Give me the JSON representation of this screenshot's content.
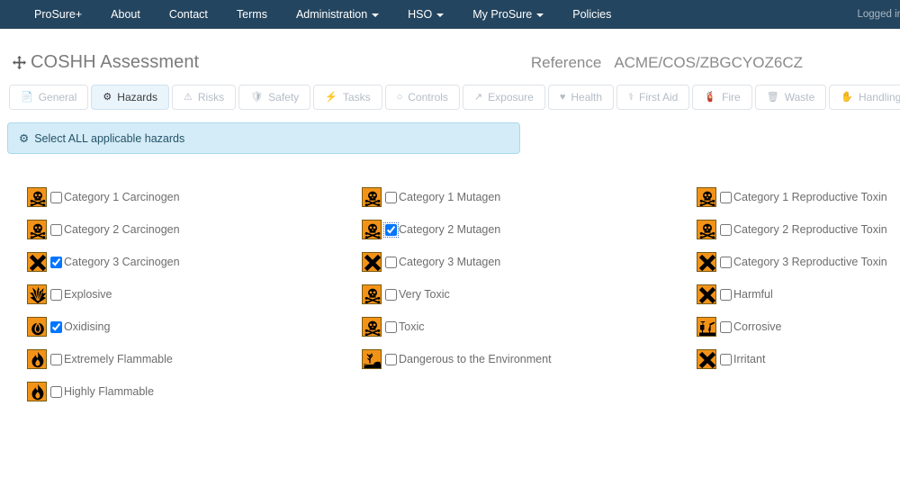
{
  "navbar": {
    "items": [
      {
        "label": "ProSure+",
        "caret": false
      },
      {
        "label": "About",
        "caret": false
      },
      {
        "label": "Contact",
        "caret": false
      },
      {
        "label": "Terms",
        "caret": false
      },
      {
        "label": "Administration",
        "caret": true
      },
      {
        "label": "HSO",
        "caret": true
      },
      {
        "label": "My ProSure",
        "caret": true
      },
      {
        "label": "Policies",
        "caret": false
      }
    ],
    "logged_in": "Logged in: Ay"
  },
  "header": {
    "title": "COSHH Assessment",
    "title_icon": "move-arrows-icon",
    "reference_label": "Reference",
    "reference_value": "ACME/COS/ZBGCYOZ6CZ"
  },
  "tabs": [
    {
      "label": "General",
      "icon": "file-icon",
      "glyph": "📄",
      "active": false
    },
    {
      "label": "Hazards",
      "icon": "gear-icon",
      "glyph": "⚙",
      "active": true
    },
    {
      "label": "Risks",
      "icon": "warning-icon",
      "glyph": "⚠",
      "active": false
    },
    {
      "label": "Safety",
      "icon": "shield-icon",
      "glyph": "🛡",
      "active": false
    },
    {
      "label": "Tasks",
      "icon": "bolt-icon",
      "glyph": "⚡",
      "active": false
    },
    {
      "label": "Controls",
      "icon": "circle-icon",
      "glyph": "○",
      "active": false
    },
    {
      "label": "Exposure",
      "icon": "external-link-icon",
      "glyph": "↗",
      "active": false
    },
    {
      "label": "Health",
      "icon": "heartbeat-icon",
      "glyph": "♥",
      "active": false
    },
    {
      "label": "First Aid",
      "icon": "medkit-icon",
      "glyph": "⚕",
      "active": false
    },
    {
      "label": "Fire",
      "icon": "fire-extinguisher-icon",
      "glyph": "🧯",
      "active": false
    },
    {
      "label": "Waste",
      "icon": "trash-icon",
      "glyph": "🗑",
      "active": false
    },
    {
      "label": "Handling",
      "icon": "hand-icon",
      "glyph": "✋",
      "active": false
    }
  ],
  "banner": {
    "icon": "gear-icon",
    "glyph": "⚙",
    "text": "Select ALL applicable hazards"
  },
  "hazards": {
    "columns": [
      {
        "items": [
          {
            "label": "Category 1 Carcinogen",
            "icon": "skull-crossbones-hazard-icon",
            "pictogram": "skull",
            "checked": false,
            "focused": false
          },
          {
            "label": "Category 2 Carcinogen",
            "icon": "skull-crossbones-hazard-icon",
            "pictogram": "skull",
            "checked": false,
            "focused": false
          },
          {
            "label": "Category 3 Carcinogen",
            "icon": "x-harmful-hazard-icon",
            "pictogram": "cross",
            "checked": true,
            "focused": false
          },
          {
            "label": "Explosive",
            "icon": "explosive-hazard-icon",
            "pictogram": "explosive",
            "checked": false,
            "focused": false
          },
          {
            "label": "Oxidising",
            "icon": "oxidising-hazard-icon",
            "pictogram": "oxidising",
            "checked": true,
            "focused": false
          },
          {
            "label": "Extremely Flammable",
            "icon": "flame-hazard-icon",
            "pictogram": "flame",
            "checked": false,
            "focused": false
          },
          {
            "label": "Highly Flammable",
            "icon": "flame-hazard-icon",
            "pictogram": "flame",
            "checked": false,
            "focused": false
          }
        ]
      },
      {
        "items": [
          {
            "label": "Category 1 Mutagen",
            "icon": "skull-crossbones-hazard-icon",
            "pictogram": "skull",
            "checked": false,
            "focused": false
          },
          {
            "label": "Category 2 Mutagen",
            "icon": "skull-crossbones-hazard-icon",
            "pictogram": "skull",
            "checked": true,
            "focused": true
          },
          {
            "label": "Category 3 Mutagen",
            "icon": "x-harmful-hazard-icon",
            "pictogram": "cross",
            "checked": false,
            "focused": false
          },
          {
            "label": "Very Toxic",
            "icon": "skull-crossbones-hazard-icon",
            "pictogram": "skull",
            "checked": false,
            "focused": false
          },
          {
            "label": "Toxic",
            "icon": "skull-crossbones-hazard-icon",
            "pictogram": "skull",
            "checked": false,
            "focused": false
          },
          {
            "label": "Dangerous to the Environment",
            "icon": "environment-hazard-icon",
            "pictogram": "environment",
            "checked": false,
            "focused": false
          }
        ]
      },
      {
        "items": [
          {
            "label": "Category 1 Reproductive Toxin",
            "icon": "skull-crossbones-hazard-icon",
            "pictogram": "skull",
            "checked": false,
            "focused": false
          },
          {
            "label": "Category 2 Reproductive Toxin",
            "icon": "skull-crossbones-hazard-icon",
            "pictogram": "skull",
            "checked": false,
            "focused": false
          },
          {
            "label": "Category 3 Reproductive Toxin",
            "icon": "x-harmful-hazard-icon",
            "pictogram": "cross",
            "checked": false,
            "focused": false
          },
          {
            "label": "Harmful",
            "icon": "x-harmful-hazard-icon",
            "pictogram": "cross",
            "checked": false,
            "focused": false
          },
          {
            "label": "Corrosive",
            "icon": "corrosive-hazard-icon",
            "pictogram": "corrosive",
            "checked": false,
            "focused": false
          },
          {
            "label": "Irritant",
            "icon": "x-harmful-hazard-icon",
            "pictogram": "cross",
            "checked": false,
            "focused": false
          }
        ]
      }
    ]
  },
  "colors": {
    "navbar_bg": "#24455f",
    "hazard_orange": "#f29318",
    "banner_bg": "#d4ecf7",
    "banner_border": "#a8d9ec",
    "banner_text": "#245269",
    "active_tab_bg": "#eaf4fb"
  }
}
